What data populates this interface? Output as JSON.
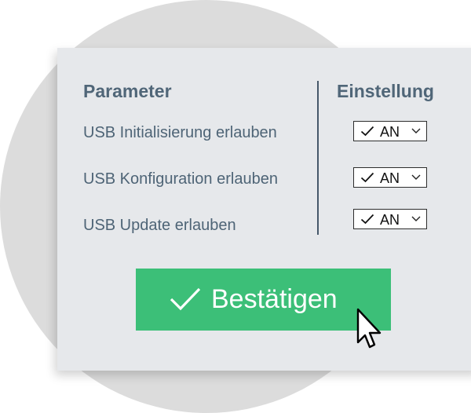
{
  "table": {
    "header_parameter": "Parameter",
    "header_setting": "Einstellung",
    "rows": [
      {
        "label": "USB Initialisierung erlauben",
        "value": "AN"
      },
      {
        "label": "USB Konfiguration erlauben",
        "value": "AN"
      },
      {
        "label": "USB Update erlauben",
        "value": "AN"
      }
    ]
  },
  "confirm_button": {
    "label": "Bestätigen"
  },
  "colors": {
    "panel_bg": "#e6e8eb",
    "text": "#4e6476",
    "button_bg": "#3cbf78"
  },
  "icons": {
    "select_check": "checkmark-icon",
    "select_arrow": "chevron-down-icon",
    "button_check": "checkmark-icon",
    "pointer": "mouse-cursor-icon"
  }
}
